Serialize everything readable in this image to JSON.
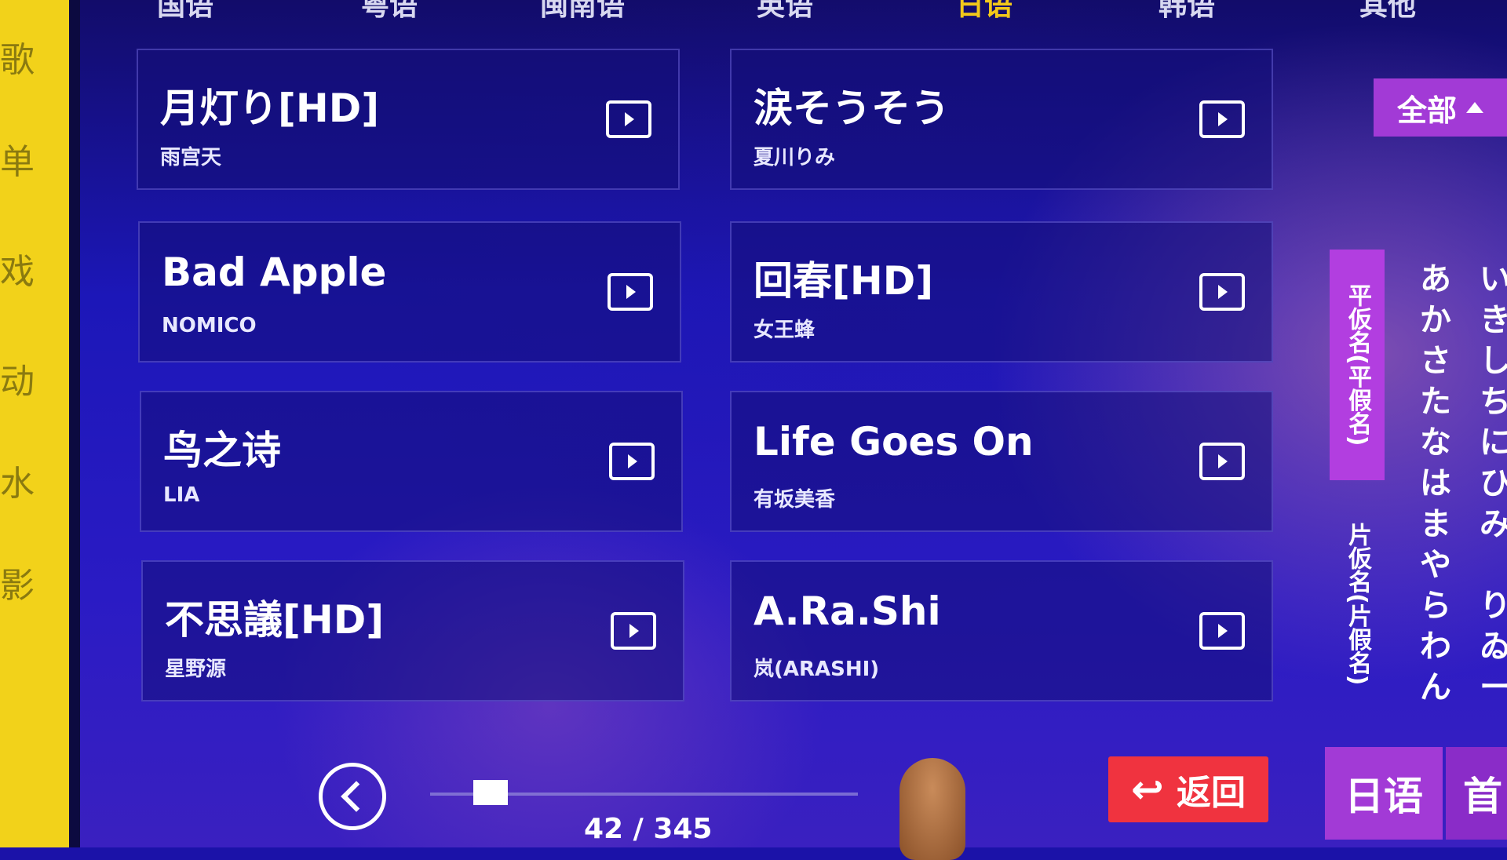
{
  "tabs": [
    "国语",
    "粤语",
    "闽南语",
    "英语",
    "日语",
    "韩语",
    "其他"
  ],
  "active_tab": "日语",
  "left_strip": [
    "歌",
    "单",
    "戏",
    "动",
    "水",
    "影"
  ],
  "songs": [
    {
      "title": "月灯り[HD]",
      "artist": "雨宫天"
    },
    {
      "title": "涙そうそう",
      "artist": "夏川りみ"
    },
    {
      "title": "Bad Apple",
      "artist": "NOMICO"
    },
    {
      "title": "回春[HD]",
      "artist": "女王蜂"
    },
    {
      "title": "鸟之诗",
      "artist": "LIA"
    },
    {
      "title": "Life Goes On",
      "artist": "有坂美香"
    },
    {
      "title": "不思議[HD]",
      "artist": "星野源"
    },
    {
      "title": "A.Ra.Shi",
      "artist": "岚(ARASHI)"
    }
  ],
  "filter": {
    "label": "全部"
  },
  "kana": {
    "hiragana_label": "平仮名(平假名)",
    "katakana_label": "片仮名(片假名)",
    "column1": [
      "あ",
      "か",
      "さ",
      "た",
      "な",
      "は",
      "ま",
      "や",
      "ら",
      "わ",
      "ん"
    ],
    "column2": [
      "い",
      "き",
      "し",
      "ち",
      "に",
      "ひ",
      "み",
      "",
      "り",
      "ゐ",
      "ー"
    ]
  },
  "pagination": {
    "current": 42,
    "total": 345,
    "text": "42 / 345",
    "progress": 0.12
  },
  "bottom": {
    "back_label": "返回",
    "lang_label": "日语",
    "home_label": "首"
  },
  "colors": {
    "accent_purple": "#a23ad6",
    "back_red": "#f0333f",
    "active_tab": "#f2c81a"
  }
}
